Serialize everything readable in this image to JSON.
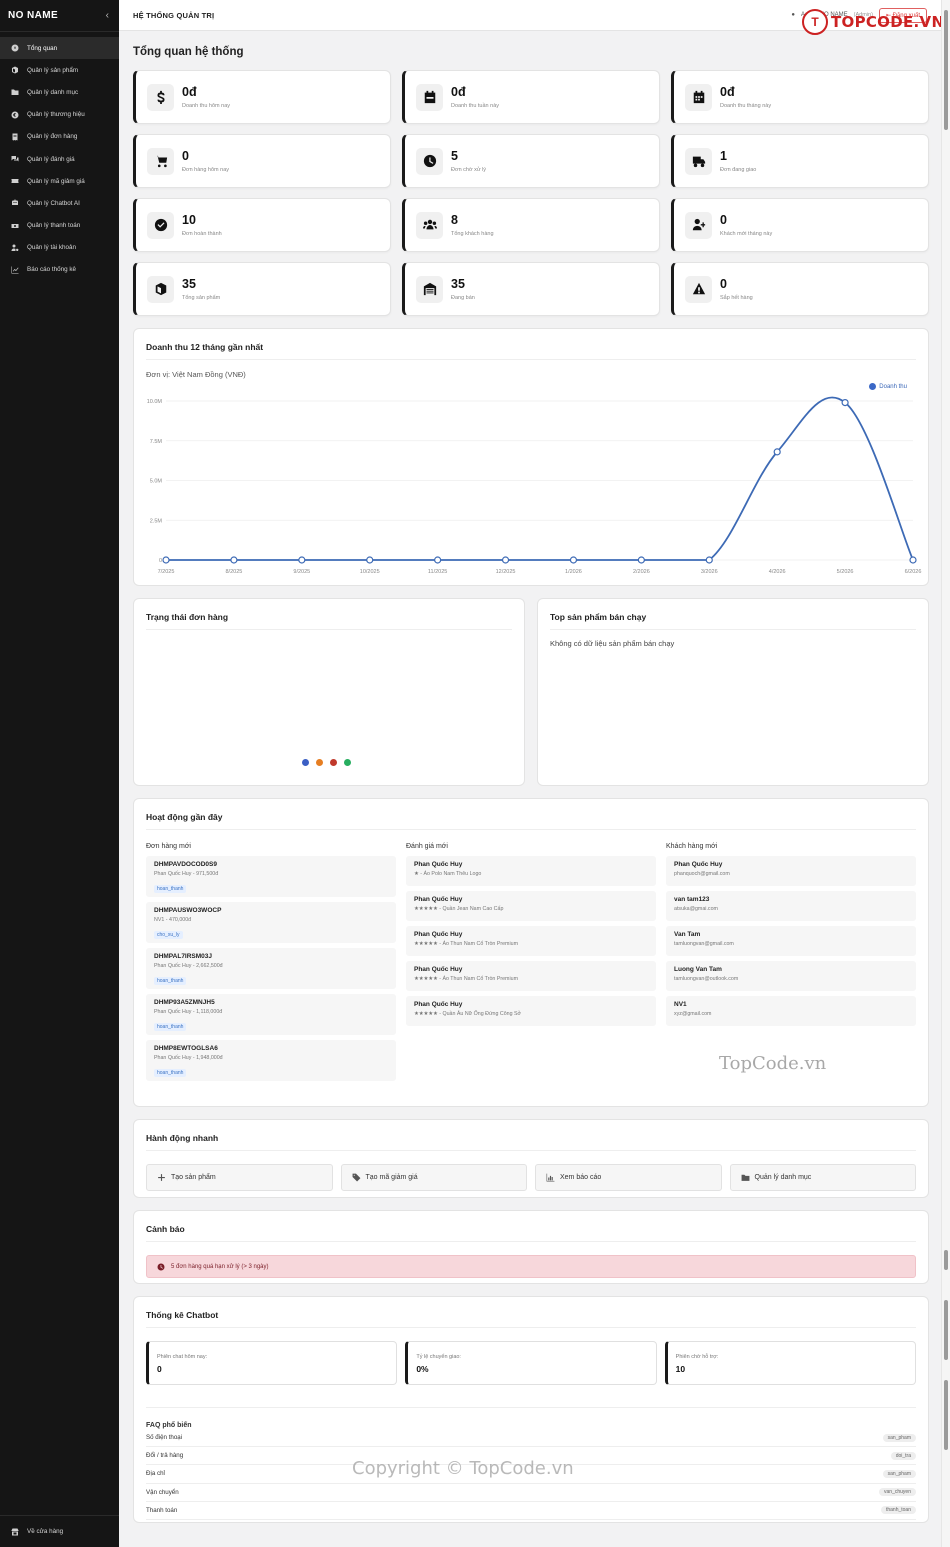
{
  "brand": {
    "name": "NO NAME",
    "collapse_icon": "chevron-left-icon"
  },
  "sidebar": {
    "items": [
      {
        "label": "Tổng quan",
        "icon": "dashboard-icon",
        "active": true
      },
      {
        "label": "Quản lý sản phẩm",
        "icon": "box-icon"
      },
      {
        "label": "Quản lý danh mục",
        "icon": "folder-icon"
      },
      {
        "label": "Quản lý thương hiệu",
        "icon": "copyright-icon"
      },
      {
        "label": "Quản lý đơn hàng",
        "icon": "receipt-icon"
      },
      {
        "label": "Quản lý đánh giá",
        "icon": "comments-icon"
      },
      {
        "label": "Quản lý mã giảm giá",
        "icon": "ticket-icon"
      },
      {
        "label": "Quản lý Chatbot AI",
        "icon": "robot-icon"
      },
      {
        "label": "Quản lý thanh toán",
        "icon": "money-icon"
      },
      {
        "label": "Quản lý tài khoản",
        "icon": "user-gear-icon"
      },
      {
        "label": "Báo cáo thống kê",
        "icon": "chart-line-icon"
      }
    ],
    "bottom": {
      "label": "Về cửa hàng",
      "icon": "store-icon"
    }
  },
  "topbar": {
    "title": "HỆ THỐNG QUẢN TRỊ",
    "user": "Admin NO NAME",
    "role": "(Admin)",
    "logout": "Đăng xuất"
  },
  "logo": {
    "mark": "T",
    "text": "TOPCODE.VN"
  },
  "page_title": "Tổng quan hệ thống",
  "stats": [
    {
      "value": "0đ",
      "label": "Doanh thu hôm nay",
      "icon": "dollar-icon"
    },
    {
      "value": "0đ",
      "label": "Doanh thu tuần này",
      "icon": "calendar-week-icon"
    },
    {
      "value": "0đ",
      "label": "Doanh thu tháng này",
      "icon": "calendar-icon"
    },
    {
      "value": "0",
      "label": "Đơn hàng hôm nay",
      "icon": "cart-icon"
    },
    {
      "value": "5",
      "label": "Đơn chờ xử lý",
      "icon": "clock-icon"
    },
    {
      "value": "1",
      "label": "Đơn đang giao",
      "icon": "truck-icon"
    },
    {
      "value": "10",
      "label": "Đơn hoàn thành",
      "icon": "check-circle-icon"
    },
    {
      "value": "8",
      "label": "Tổng khách hàng",
      "icon": "users-icon"
    },
    {
      "value": "0",
      "label": "Khách mới tháng này",
      "icon": "user-plus-icon"
    },
    {
      "value": "35",
      "label": "Tổng sản phẩm",
      "icon": "box-icon"
    },
    {
      "value": "35",
      "label": "Đang bán",
      "icon": "warehouse-icon"
    },
    {
      "value": "0",
      "label": "Sắp hết hàng",
      "icon": "warning-icon"
    }
  ],
  "revenue_card": {
    "title": "Doanh thu 12 tháng gần nhất",
    "unit": "Đơn vị: Việt Nam Đồng (VNĐ)"
  },
  "chart_data": {
    "type": "line",
    "title": "",
    "xlabel": "",
    "ylabel": "",
    "x": [
      "7/2025",
      "8/2025",
      "9/2025",
      "10/2025",
      "11/2025",
      "12/2025",
      "1/2026",
      "2/2026",
      "3/2026",
      "4/2026",
      "5/2026",
      "6/2026"
    ],
    "series": [
      {
        "name": "Doanh thu",
        "values": [
          0,
          0,
          0,
          0,
          0,
          0,
          0,
          0,
          0,
          6800000,
          9900000,
          0
        ],
        "color": "#3d6ab5"
      }
    ],
    "yticks": [
      0,
      2500000,
      5000000,
      7500000,
      10000000
    ],
    "ytick_labels": [
      "0",
      "2.5M",
      "5.0M",
      "7.5M",
      "10.0M"
    ],
    "ylim": [
      0,
      10000000
    ],
    "grid": true,
    "legend": "top-right"
  },
  "order_status": {
    "title": "Trạng thái đơn hàng",
    "dot_colors": [
      "#3b5fc4",
      "#e67e22",
      "#c0392b",
      "#27ae60"
    ]
  },
  "top_products": {
    "title": "Top sản phẩm bán chạy",
    "empty": "Không có dữ liệu sản phẩm bán chạy"
  },
  "activity": {
    "title": "Hoạt động gần đây",
    "orders_title": "Đơn hàng mới",
    "orders": [
      {
        "code": "DHMPAVDOCOD0S9",
        "detail": "Phan Quốc Huy - 971,500đ",
        "status": "hoan_thanh"
      },
      {
        "code": "DHMPAUSWO3WOCP",
        "detail": "NV1 - 470,000đ",
        "status": "cho_xu_ly"
      },
      {
        "code": "DHMPAL7IRSM03J",
        "detail": "Phan Quốc Huy - 2,662,500đ",
        "status": "hoan_thanh"
      },
      {
        "code": "DHMP93A5ZMNJH5",
        "detail": "Phan Quốc Huy - 1,118,000đ",
        "status": "hoan_thanh"
      },
      {
        "code": "DHMP8EWTOGLSA6",
        "detail": "Phan Quốc Huy - 1,948,000đ",
        "status": "hoan_thanh"
      }
    ],
    "reviews_title": "Đánh giá mới",
    "reviews": [
      {
        "name": "Phan Quốc Huy",
        "detail": "★ - Áo Polo Nam Thêu Logo"
      },
      {
        "name": "Phan Quốc Huy",
        "detail": "★★★★★ - Quần Jean Nam Cao Cấp"
      },
      {
        "name": "Phan Quốc Huy",
        "detail": "★★★★★ - Áo Thun Nam Cổ Tròn Premium"
      },
      {
        "name": "Phan Quốc Huy",
        "detail": "★★★★★ - Áo Thun Nam Cổ Tròn Premium"
      },
      {
        "name": "Phan Quốc Huy",
        "detail": "★★★★★ - Quần Âu Nữ Ống Đứng Công Sở"
      }
    ],
    "customers_title": "Khách hàng mới",
    "customers": [
      {
        "name": "Phan Quốc Huy",
        "email": "phanquoch@gmail.com"
      },
      {
        "name": "van tam123",
        "email": "atsuka@gmai.com"
      },
      {
        "name": "Van Tam",
        "email": "tamluongvan@gmail.com"
      },
      {
        "name": "Luong Van Tam",
        "email": "tamluongvan@outlook.com"
      },
      {
        "name": "NV1",
        "email": "xyz@gmail.com"
      }
    ]
  },
  "quick_actions": {
    "title": "Hành động nhanh",
    "items": [
      {
        "label": "Tạo sản phẩm",
        "icon": "plus-icon"
      },
      {
        "label": "Tạo mã giảm giá",
        "icon": "tags-icon"
      },
      {
        "label": "Xem báo cáo",
        "icon": "chart-icon"
      },
      {
        "label": "Quản lý danh mục",
        "icon": "folder-icon"
      }
    ]
  },
  "warnings": {
    "title": "Cảnh báo",
    "alert": "5 đơn hàng quá hạn xử lý (> 3 ngày)",
    "icon": "clock-icon"
  },
  "chatbot": {
    "title": "Thống kê Chatbot",
    "stats": [
      {
        "label": "Phiên chat hôm nay:",
        "value": "0"
      },
      {
        "label": "Tỷ lệ chuyển giao:",
        "value": "0%"
      },
      {
        "label": "Phiên chờ hỗ trợ:",
        "value": "10"
      }
    ],
    "faq_title": "FAQ phổ biến",
    "faq": [
      {
        "q": "Số điện thoại",
        "tag": "san_pham"
      },
      {
        "q": "Đổi / trả hàng",
        "tag": "doi_tra"
      },
      {
        "q": "Địa chỉ",
        "tag": "san_pham"
      },
      {
        "q": "Vận chuyển",
        "tag": "van_chuyen"
      },
      {
        "q": "Thanh toán",
        "tag": "thanh_toan"
      }
    ]
  },
  "watermarks": {
    "center": "TopCode.vn",
    "bottom": "Copyright © TopCode.vn"
  }
}
